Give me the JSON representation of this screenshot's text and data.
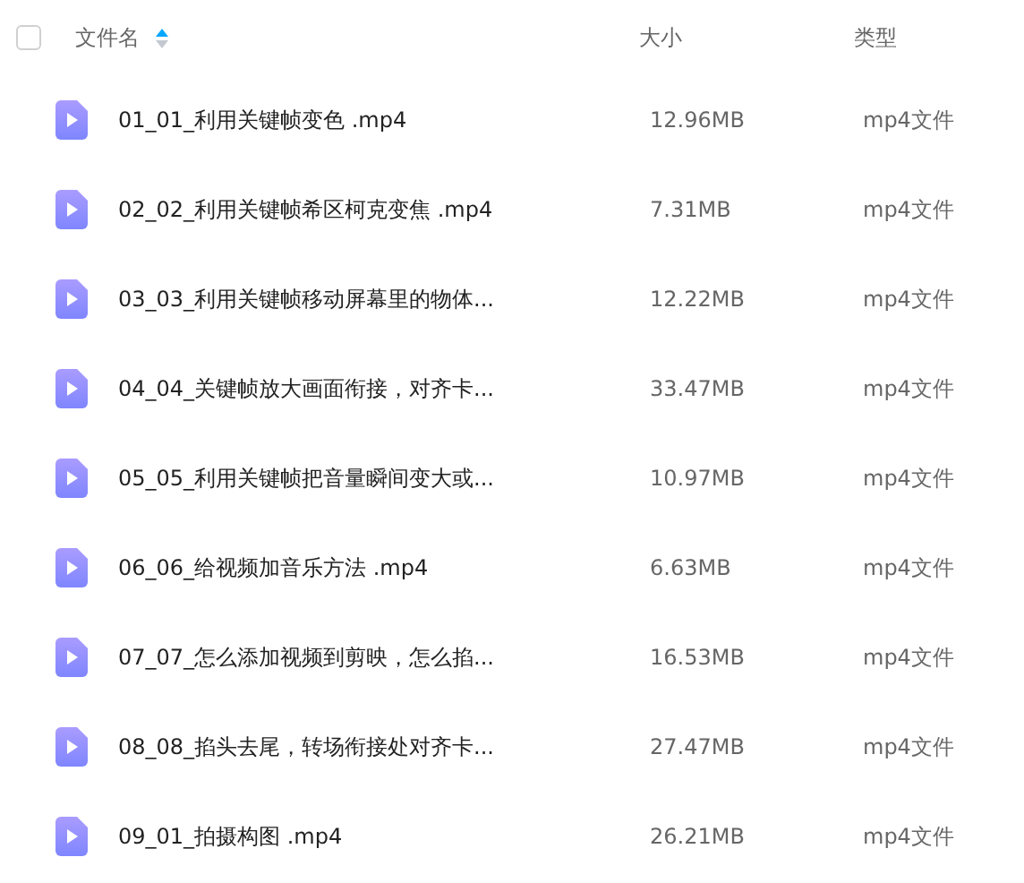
{
  "header": {
    "checked": false,
    "columns": [
      {
        "label": "文件名",
        "sort_ascending": true
      },
      {
        "label": "大小"
      },
      {
        "label": "类型"
      }
    ]
  },
  "files": [
    {
      "name": "01_01_利用关键帧变色 .mp4",
      "size": "12.96MB",
      "type": "mp4文件"
    },
    {
      "name": "02_02_利用关键帧希区柯克变焦 .mp4",
      "size": "7.31MB",
      "type": "mp4文件"
    },
    {
      "name": "03_03_利用关键帧移动屏幕里的物体...",
      "size": "12.22MB",
      "type": "mp4文件"
    },
    {
      "name": "04_04_关键帧放大画面衔接，对齐卡...",
      "size": "33.47MB",
      "type": "mp4文件"
    },
    {
      "name": "05_05_利用关键帧把音量瞬间变大或...",
      "size": "10.97MB",
      "type": "mp4文件"
    },
    {
      "name": "06_06_给视频加音乐方法 .mp4",
      "size": "6.63MB",
      "type": "mp4文件"
    },
    {
      "name": "07_07_怎么添加视频到剪映，怎么掐...",
      "size": "16.53MB",
      "type": "mp4文件"
    },
    {
      "name": "08_08_掐头去尾，转场衔接处对齐卡...",
      "size": "27.47MB",
      "type": "mp4文件"
    },
    {
      "name": "09_01_拍摄构图 .mp4",
      "size": "26.21MB",
      "type": "mp4文件"
    }
  ]
}
